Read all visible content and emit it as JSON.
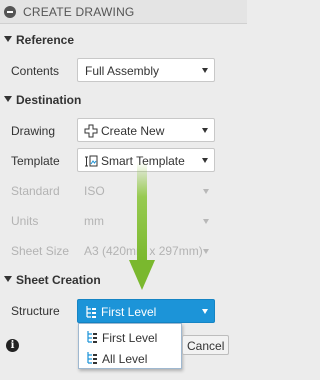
{
  "title": "CREATE DRAWING",
  "sections": {
    "reference": "Reference",
    "destination": "Destination",
    "sheet_creation": "Sheet Creation"
  },
  "reference": {
    "contents_label": "Contents",
    "contents_value": "Full Assembly"
  },
  "destination": {
    "drawing_label": "Drawing",
    "drawing_value": "Create New",
    "template_label": "Template",
    "template_value": "Smart Template",
    "standard_label": "Standard",
    "standard_value": "ISO",
    "units_label": "Units",
    "units_value": "mm",
    "sheet_size_label": "Sheet Size",
    "sheet_size_value": "A3 (420mm x 297mm)"
  },
  "sheet_creation": {
    "structure_label": "Structure",
    "structure_value": "First Level",
    "options": [
      "First Level",
      "All Level"
    ]
  },
  "footer": {
    "cancel_label": "Cancel",
    "info_symbol": "i"
  },
  "colors": {
    "accent": "#1c94d8",
    "arrow": "#8dc63f"
  },
  "icons": {
    "collapse": "minus-circle-icon",
    "drawing": "plus-crosshair-icon",
    "template": "smart-template-icon",
    "structure": "tree-structure-icon"
  }
}
